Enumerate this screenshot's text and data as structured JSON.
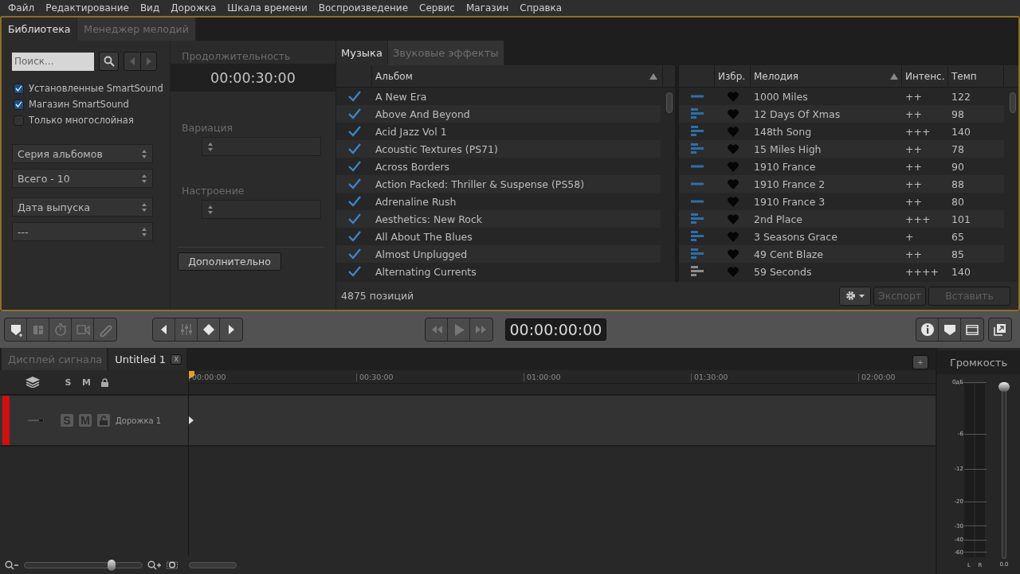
{
  "menu": [
    "Файл",
    "Редактирование",
    "Вид",
    "Дорожка",
    "Шкала времени",
    "Воспроизведение",
    "Сервис",
    "Магазин",
    "Справка"
  ],
  "library": {
    "tabs": [
      {
        "label": "Библиотека",
        "selected": true
      },
      {
        "label": "Менеджер мелодий",
        "selected": false
      }
    ],
    "search": {
      "placeholder": "Поиск..."
    },
    "checkboxes": [
      {
        "label": "Установленные SmartSound",
        "checked": true
      },
      {
        "label": "Магазин SmartSound",
        "checked": true
      },
      {
        "label": "Только многослойная",
        "checked": false
      }
    ],
    "filters": [
      {
        "value": "Серия альбомов"
      },
      {
        "value": "Всего - 10"
      },
      {
        "value": "Дата выпуска"
      },
      {
        "value": "---"
      }
    ],
    "duration": {
      "label": "Продолжительность",
      "value": "00:00:30:00"
    },
    "options": [
      {
        "label": "Вариация",
        "disabled": true
      },
      {
        "label": "Настроение",
        "disabled": true
      }
    ],
    "more_button": "Дополнительно"
  },
  "music": {
    "tabs": [
      {
        "label": "Музыка",
        "selected": true
      },
      {
        "label": "Звуковые эффекты",
        "selected": false
      }
    ],
    "albums": {
      "column": "Альбом",
      "rows": [
        {
          "name": "A New Era",
          "checked": true
        },
        {
          "name": "Above And Beyond",
          "checked": true
        },
        {
          "name": "Acid Jazz Vol 1",
          "checked": true
        },
        {
          "name": "Acoustic Textures (PS71)",
          "checked": true
        },
        {
          "name": "Across Borders",
          "checked": true
        },
        {
          "name": "Action Packed: Thriller & Suspense (PS58)",
          "checked": true
        },
        {
          "name": "Adrenaline Rush",
          "checked": true
        },
        {
          "name": "Aesthetics: New Rock",
          "checked": true
        },
        {
          "name": "All About The Blues",
          "checked": true
        },
        {
          "name": "Almost Unplugged",
          "checked": true
        },
        {
          "name": "Alternating Currents",
          "checked": true
        }
      ]
    },
    "melodies": {
      "columns": [
        "Избр.",
        "Мелодия",
        "Интенс.",
        "Темп"
      ],
      "rows": [
        {
          "kind": "single",
          "color": "#2f6fa8",
          "title": "1000 Miles",
          "intensity": "++",
          "tempo": "122"
        },
        {
          "kind": "layered",
          "color": "#2f6fa8",
          "title": "12 Days Of Xmas",
          "intensity": "++",
          "tempo": "98"
        },
        {
          "kind": "layered",
          "color": "#2f6fa8",
          "title": "148th Song",
          "intensity": "+++",
          "tempo": "140"
        },
        {
          "kind": "layered",
          "color": "#2f6fa8",
          "title": "15 Miles High",
          "intensity": "++",
          "tempo": "78"
        },
        {
          "kind": "single",
          "color": "#2f6fa8",
          "title": "1910 France",
          "intensity": "++",
          "tempo": "90"
        },
        {
          "kind": "single",
          "color": "#2f6fa8",
          "title": "1910 France 2",
          "intensity": "++",
          "tempo": "88"
        },
        {
          "kind": "single",
          "color": "#2f6fa8",
          "title": "1910 France 3",
          "intensity": "++",
          "tempo": "80"
        },
        {
          "kind": "layered",
          "color": "#2f6fa8",
          "title": "2nd Place",
          "intensity": "+++",
          "tempo": "101"
        },
        {
          "kind": "layered",
          "color": "#2f6fa8",
          "title": "3 Seasons Grace",
          "intensity": "+",
          "tempo": "65"
        },
        {
          "kind": "layered",
          "color": "#2f6fa8",
          "title": "49 Cent Blaze",
          "intensity": "++",
          "tempo": "85"
        },
        {
          "kind": "layered",
          "color": "#8c8c8c",
          "title": "59 Seconds",
          "intensity": "++++",
          "tempo": "140"
        }
      ]
    },
    "count": "4875 позиций",
    "buttons": [
      {
        "label": "Экспорт",
        "disabled": true
      },
      {
        "label": "Вставить",
        "disabled": true
      }
    ]
  },
  "toolbar": {
    "groups": [
      [
        {
          "kind": "marker-add",
          "disabled": false
        },
        {
          "kind": "split",
          "disabled": true
        },
        {
          "kind": "timer",
          "disabled": true
        },
        {
          "kind": "video",
          "disabled": true
        },
        {
          "kind": "link",
          "disabled": true
        }
      ],
      [
        {
          "kind": "prev",
          "disabled": false
        },
        {
          "kind": "mixer",
          "disabled": true
        },
        {
          "kind": "keyframe",
          "disabled": false
        },
        {
          "kind": "next",
          "disabled": false
        }
      ],
      [
        {
          "kind": "rewind",
          "disabled": true
        },
        {
          "kind": "play",
          "disabled": true
        },
        {
          "kind": "forward",
          "disabled": true
        }
      ]
    ],
    "timecode": "00:00:00:00",
    "right_groups": [
      [
        {
          "kind": "info",
          "disabled": false
        },
        {
          "kind": "marker",
          "disabled": false
        },
        {
          "kind": "film",
          "disabled": false
        }
      ],
      [
        {
          "kind": "popout",
          "disabled": false
        }
      ]
    ]
  },
  "timeline": {
    "tabs": [
      {
        "label": "Дисплей сигнала",
        "selected": false,
        "closable": false
      },
      {
        "label": "Untitled 1",
        "selected": true,
        "closable": true
      }
    ],
    "close_label": "x",
    "add_label": "+",
    "header": {
      "solo": "S",
      "mute": "M"
    },
    "ruler": [
      "00:00:00",
      "00:30:00",
      "01:00:00",
      "01:30:00",
      "02:00:00"
    ],
    "tracks": [
      {
        "name": "Дорожка 1",
        "solo": "S",
        "mute": "M",
        "color": "#d01010"
      }
    ],
    "zoom": {
      "level": 0.74
    }
  },
  "volume": {
    "title": "Громкость",
    "scale": [
      "0дБ",
      "-6",
      "-12",
      "-20",
      "-30",
      "-40",
      "-60"
    ],
    "channels": [
      "L",
      "R"
    ],
    "reading": "0.0",
    "level": 1
  }
}
